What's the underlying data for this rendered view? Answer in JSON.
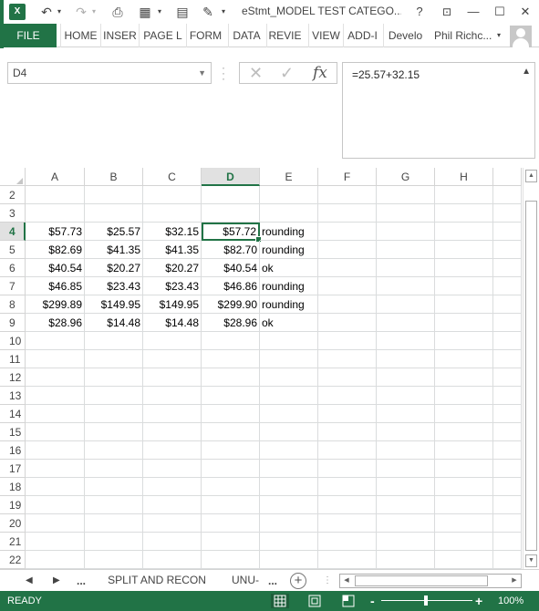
{
  "window": {
    "title": "eStmt_MODEL TEST CATEGO...",
    "help": "?",
    "app_logo": "X"
  },
  "ribbon": {
    "file": "FILE",
    "tabs": [
      "HOME",
      "INSER",
      "PAGE L",
      "FORM",
      "DATA",
      "REVIE",
      "VIEW",
      "ADD-I",
      "Develo"
    ],
    "user": "Phil Richc..."
  },
  "formula_bar": {
    "name_box": "D4",
    "fx": "fx",
    "formula": "=25.57+32.15"
  },
  "grid": {
    "columns": [
      "A",
      "B",
      "C",
      "D",
      "E",
      "F",
      "G",
      "H"
    ],
    "selected_column": "D",
    "selected_row": "4",
    "rows": [
      {
        "num": "2",
        "cells": [
          "",
          "",
          "",
          "",
          ""
        ]
      },
      {
        "num": "3",
        "cells": [
          "",
          "",
          "",
          "",
          ""
        ]
      },
      {
        "num": "4",
        "cells": [
          "$57.73",
          "$25.57",
          "$32.15",
          "$57.72",
          "rounding"
        ]
      },
      {
        "num": "5",
        "cells": [
          "$82.69",
          "$41.35",
          "$41.35",
          "$82.70",
          "rounding"
        ]
      },
      {
        "num": "6",
        "cells": [
          "$40.54",
          "$20.27",
          "$20.27",
          "$40.54",
          "ok"
        ]
      },
      {
        "num": "7",
        "cells": [
          "$46.85",
          "$23.43",
          "$23.43",
          "$46.86",
          "rounding"
        ]
      },
      {
        "num": "8",
        "cells": [
          "$299.89",
          "$149.95",
          "$149.95",
          "$299.90",
          "rounding"
        ]
      },
      {
        "num": "9",
        "cells": [
          "$28.96",
          "$14.48",
          "$14.48",
          "$28.96",
          "ok"
        ]
      },
      {
        "num": "10",
        "cells": [
          "",
          "",
          "",
          "",
          ""
        ]
      },
      {
        "num": "11",
        "cells": [
          "",
          "",
          "",
          "",
          ""
        ]
      },
      {
        "num": "12",
        "cells": [
          "",
          "",
          "",
          "",
          ""
        ]
      },
      {
        "num": "13",
        "cells": [
          "",
          "",
          "",
          "",
          ""
        ]
      },
      {
        "num": "14",
        "cells": [
          "",
          "",
          "",
          "",
          ""
        ]
      },
      {
        "num": "15",
        "cells": [
          "",
          "",
          "",
          "",
          ""
        ]
      },
      {
        "num": "16",
        "cells": [
          "",
          "",
          "",
          "",
          ""
        ]
      },
      {
        "num": "17",
        "cells": [
          "",
          "",
          "",
          "",
          ""
        ]
      },
      {
        "num": "18",
        "cells": [
          "",
          "",
          "",
          "",
          ""
        ]
      },
      {
        "num": "19",
        "cells": [
          "",
          "",
          "",
          "",
          ""
        ]
      },
      {
        "num": "20",
        "cells": [
          "",
          "",
          "",
          "",
          ""
        ]
      },
      {
        "num": "21",
        "cells": [
          "",
          "",
          "",
          "",
          ""
        ]
      },
      {
        "num": "22",
        "cells": [
          "",
          "",
          "",
          "",
          ""
        ]
      }
    ]
  },
  "sheet_tabs": {
    "more_left": "...",
    "tabs": [
      "SPLIT AND RECON",
      "UNU-"
    ],
    "more_right": "..."
  },
  "status_bar": {
    "status": "READY",
    "zoom": "100%",
    "zoom_minus": "-",
    "zoom_plus": "+"
  }
}
